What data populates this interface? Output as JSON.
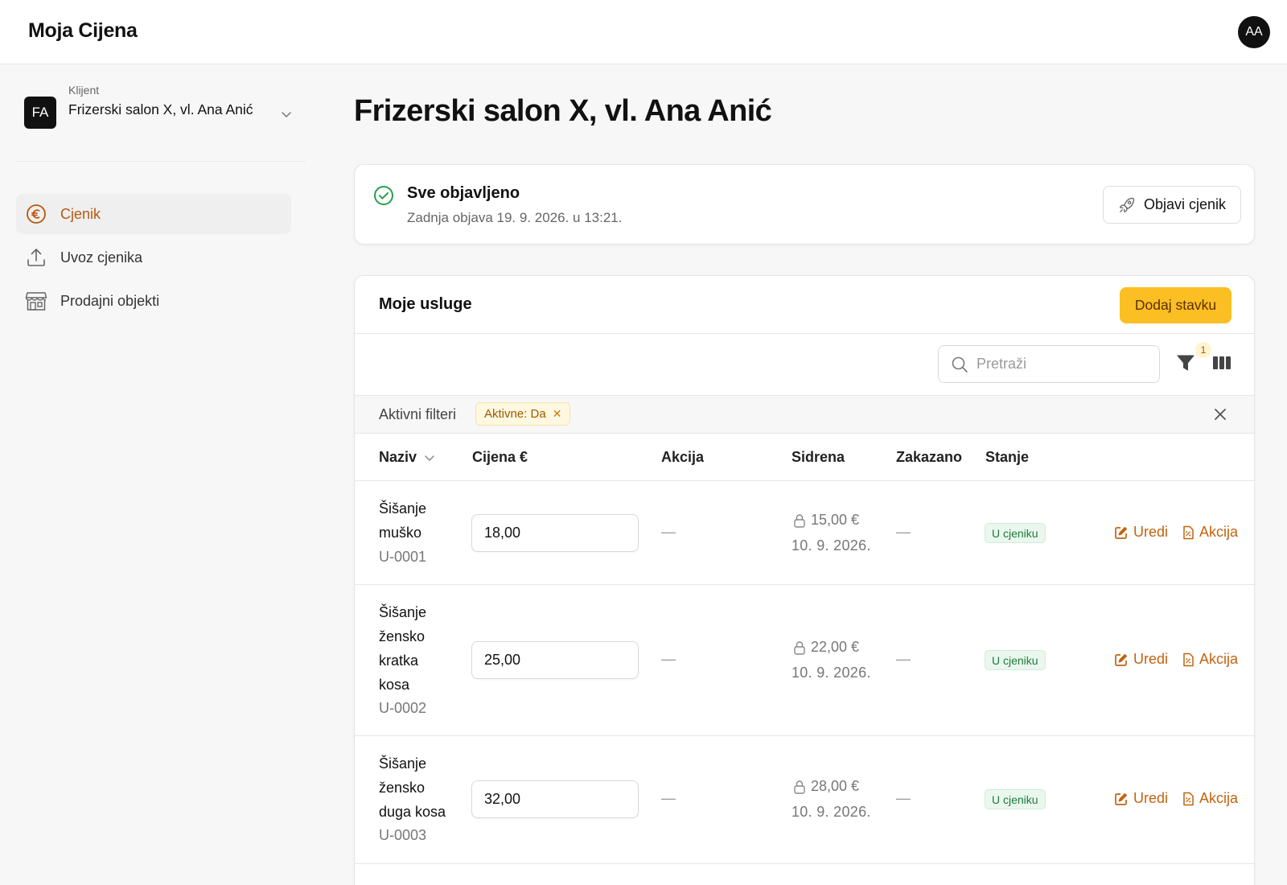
{
  "app": {
    "title": "Moja Cijena",
    "user_initials": "AA"
  },
  "sidebar": {
    "client_caption": "Klijent",
    "client_initials": "FA",
    "client_name": "Frizerski salon X, vl. Ana Anić",
    "items": [
      {
        "label": "Cjenik",
        "icon": "euro-circle-icon",
        "active": true
      },
      {
        "label": "Uvoz cjenika",
        "icon": "upload-icon",
        "active": false
      },
      {
        "label": "Prodajni objekti",
        "icon": "store-icon",
        "active": false
      }
    ]
  },
  "page": {
    "title": "Frizerski salon X, vl. Ana Anić"
  },
  "status": {
    "title": "Sve objavljeno",
    "subtitle": "Zadnja objava 19. 9. 2026. u 13:21.",
    "publish_label": "Objavi cjenik"
  },
  "services": {
    "title": "Moje usluge",
    "add_label": "Dodaj stavku",
    "search_placeholder": "Pretraži",
    "filter_count": "1",
    "active_filters_label": "Aktivni filteri",
    "filter_chip": "Aktivne: Da",
    "columns": {
      "name": "Naziv",
      "price": "Cijena €",
      "promo": "Akcija",
      "anchor": "Sidrena",
      "scheduled": "Zakazano",
      "state": "Stanje"
    },
    "rows": [
      {
        "name_lines": [
          "Šišanje",
          "muško"
        ],
        "code": "U-0001",
        "price": "18,00",
        "promo": "—",
        "anchor_price": "15,00 €",
        "anchor_date": "10. 9. 2026.",
        "scheduled": "—",
        "state": "U cjeniku",
        "edit_label": "Uredi",
        "promo_label": "Akcija"
      },
      {
        "name_lines": [
          "Šišanje",
          "žensko",
          "kratka",
          "kosa"
        ],
        "code": "U-0002",
        "price": "25,00",
        "promo": "—",
        "anchor_price": "22,00 €",
        "anchor_date": "10. 9. 2026.",
        "scheduled": "—",
        "state": "U cjeniku",
        "edit_label": "Uredi",
        "promo_label": "Akcija"
      },
      {
        "name_lines": [
          "Šišanje",
          "žensko",
          "duga kosa"
        ],
        "code": "U-0003",
        "price": "32,00",
        "promo": "—",
        "anchor_price": "28,00 €",
        "anchor_date": "10. 9. 2026.",
        "scheduled": "—",
        "state": "U cjeniku",
        "edit_label": "Uredi",
        "promo_label": "Akcija"
      }
    ]
  },
  "colors": {
    "accent": "#b8580f",
    "primary_button": "#fbbf24",
    "success": "#1d7a3a",
    "link": "#c2630f"
  }
}
